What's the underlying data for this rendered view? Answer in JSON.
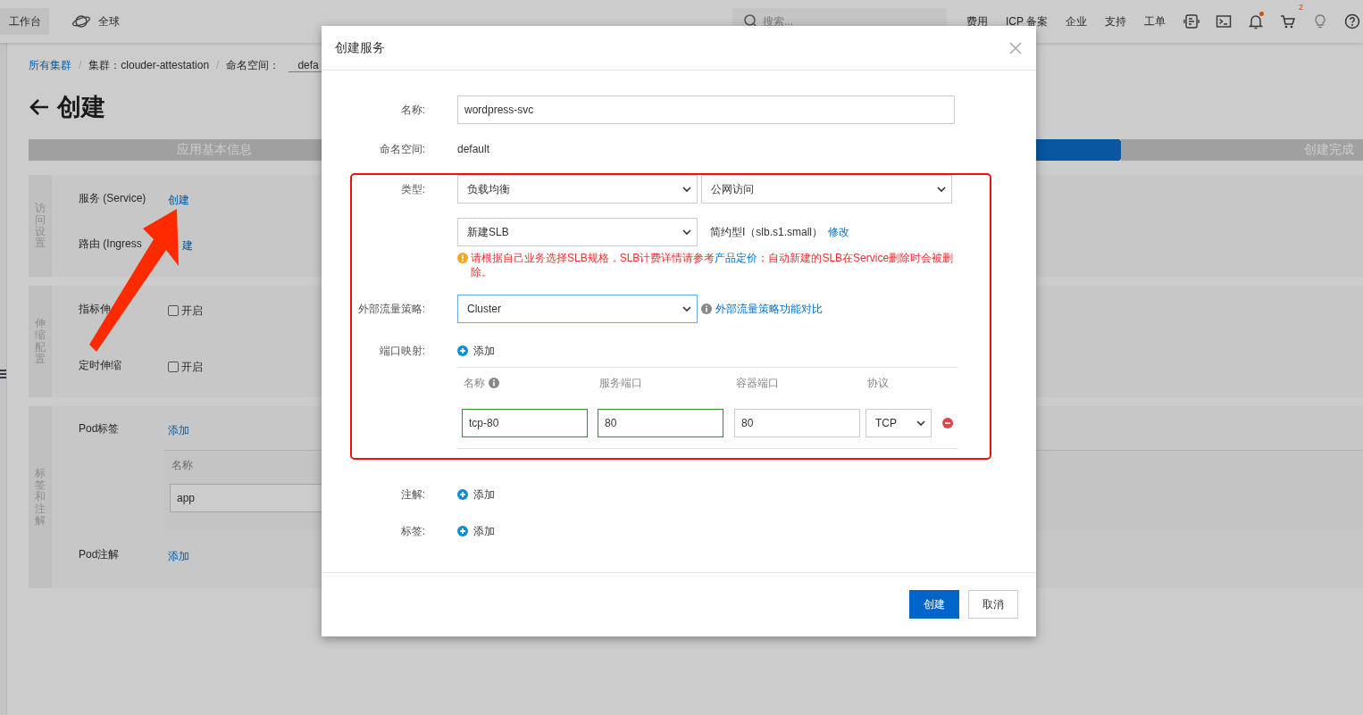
{
  "topbar": {
    "workbench": "工作台",
    "region": "全球",
    "search": {
      "placeholder": "搜索..."
    },
    "nav": [
      "费用",
      "ICP 备案",
      "企业",
      "支持",
      "工单"
    ],
    "icons": [
      {
        "kind": "api"
      },
      {
        "kind": "terminal"
      },
      {
        "kind": "bell",
        "dot": true
      },
      {
        "kind": "cart",
        "badge": "2"
      },
      {
        "kind": "bulb"
      },
      {
        "kind": "help"
      }
    ]
  },
  "breadcrumb": {
    "separator": "/",
    "items": [
      {
        "label": "所有集群",
        "link": true
      },
      {
        "label": "集群：clouder-attestation",
        "link": false
      }
    ],
    "namespace": {
      "label": "命名空间：",
      "value": "defa"
    }
  },
  "title": "创建",
  "steps": [
    {
      "label": "应用基本信息",
      "selected": false
    },
    {
      "selected": true
    },
    {
      "label": "创建完成",
      "selected": false
    }
  ],
  "sections": [
    {
      "title": "访问设置",
      "rows": [
        {
          "label": "服务 (Service)",
          "kind": "link",
          "value": "创建"
        },
        {
          "label": "路由 (Ingress",
          "kind": "clipped-link",
          "value": "建"
        }
      ]
    },
    {
      "title": "伸缩配置",
      "rows": [
        {
          "label": "指标伸",
          "kind": "checkbox",
          "value": "开启",
          "checked": false
        },
        {
          "label": "定时伸缩",
          "kind": "checkbox",
          "value": "开启",
          "checked": false
        }
      ]
    },
    {
      "title": "标签和注解",
      "rows": [
        {
          "label": "Pod标签",
          "kind": "link",
          "value": "添加",
          "table": {
            "columns": [
              "名称"
            ],
            "rows": [
              [
                "app"
              ]
            ]
          }
        },
        {
          "label": "Pod注解",
          "kind": "link",
          "value": "添加"
        }
      ]
    }
  ],
  "dialog": {
    "title": "创建服务",
    "name": {
      "label": "名称:",
      "value": "wordpress-svc"
    },
    "namespace": {
      "label": "命名空间:",
      "value": "default"
    },
    "type": {
      "label": "类型:",
      "selects": [
        "负载均衡",
        "公网访问"
      ]
    },
    "slb": {
      "select": "新建SLB",
      "spec": "简约型I（slb.s1.small）",
      "edit_link": "修改",
      "warning": {
        "before": "请根据自己业务选择SLB规格，SLB计费详情请参考",
        "link": "产品定价",
        "after": "；自动新建的SLB在Service删除时会被删除。"
      }
    },
    "traffic_policy": {
      "label": "外部流量策略:",
      "value": "Cluster",
      "focused": true,
      "help_link": "外部流量策略功能对比"
    },
    "ports": {
      "label": "端口映射:",
      "add": "添加",
      "columns": [
        {
          "label": "名称",
          "info": true
        },
        {
          "label": "服务端口",
          "info": false
        },
        {
          "label": "容器端口",
          "info": false
        },
        {
          "label": "协议",
          "info": false
        }
      ],
      "rows": [
        {
          "name": "tcp-80",
          "name_valid": true,
          "service_port": "80",
          "service_port_valid": true,
          "container_port": "80",
          "container_port_valid": false,
          "protocol": "TCP"
        }
      ]
    },
    "annotations": {
      "label": "注解:",
      "add": "添加"
    },
    "labels": {
      "label": "标签:",
      "add": "添加"
    },
    "buttons": [
      {
        "label": "创建",
        "kind": "primary"
      },
      {
        "label": "取消",
        "kind": "default"
      }
    ]
  }
}
